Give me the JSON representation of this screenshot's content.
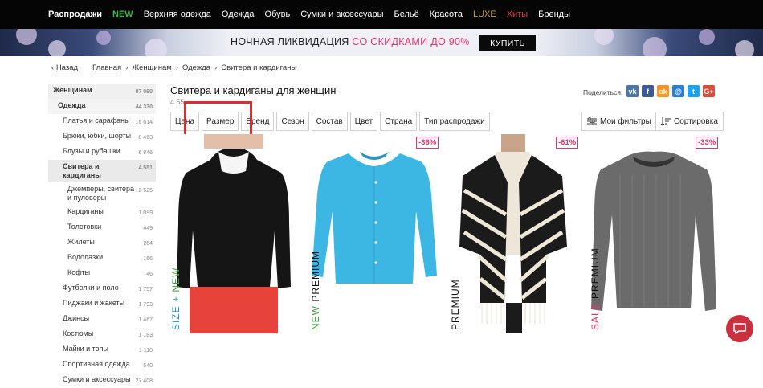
{
  "nav": {
    "items": [
      {
        "label": "Распродажи",
        "style": "bold"
      },
      {
        "label": "NEW",
        "style": "new"
      },
      {
        "label": "Верхняя одежда",
        "style": ""
      },
      {
        "label": "Одежда",
        "style": "under"
      },
      {
        "label": "Обувь",
        "style": ""
      },
      {
        "label": "Сумки и аксессуары",
        "style": ""
      },
      {
        "label": "Бельё",
        "style": ""
      },
      {
        "label": "Красота",
        "style": ""
      },
      {
        "label": "LUXE",
        "style": "luxe"
      },
      {
        "label": "Хиты",
        "style": "hits"
      },
      {
        "label": "Бренды",
        "style": ""
      }
    ]
  },
  "banner": {
    "text_main": "НОЧНАЯ ЛИКВИДАЦИЯ ",
    "text_accent": "СО СКИДКАМИ ДО 90%",
    "button": "КУПИТЬ"
  },
  "breadcrumb": {
    "back": "Назад",
    "items": [
      "Главная",
      "Женщинам",
      "Одежда"
    ],
    "current": "Свитера и кардиганы"
  },
  "sidebar": [
    {
      "label": "Женщинам",
      "count": "97 090",
      "level": "lvl0"
    },
    {
      "label": "Одежда",
      "count": "44 330",
      "level": "lvl1"
    },
    {
      "label": "Платья и сарафаны",
      "count": "16 614",
      "level": "lvl2"
    },
    {
      "label": "Брюки, юбки, шорты",
      "count": "8 463",
      "level": "lvl2"
    },
    {
      "label": "Блузы и рубашки",
      "count": "6 846",
      "level": "lvl2"
    },
    {
      "label": "Свитера и кардиганы",
      "count": "4 551",
      "level": "lvl2 active"
    },
    {
      "label": "Джемперы, свитера и пуловеры",
      "count": "2 525",
      "level": "lvl3"
    },
    {
      "label": "Кардиганы",
      "count": "1 099",
      "level": "lvl3"
    },
    {
      "label": "Толстовки",
      "count": "449",
      "level": "lvl3"
    },
    {
      "label": "Жилеты",
      "count": "264",
      "level": "lvl3"
    },
    {
      "label": "Водолазки",
      "count": "166",
      "level": "lvl3"
    },
    {
      "label": "Кофты",
      "count": "46",
      "level": "lvl3"
    },
    {
      "label": "Футболки и поло",
      "count": "1 757",
      "level": "lvl2"
    },
    {
      "label": "Пиджаки и жакеты",
      "count": "1 793",
      "level": "lvl2"
    },
    {
      "label": "Джинсы",
      "count": "1 467",
      "level": "lvl2"
    },
    {
      "label": "Костюмы",
      "count": "1 183",
      "level": "lvl2"
    },
    {
      "label": "Майки и топы",
      "count": "1 110",
      "level": "lvl2"
    },
    {
      "label": "Спортивная одежда",
      "count": "540",
      "level": "lvl2"
    },
    {
      "label": "Сумки и аксессуары",
      "count": "27 408",
      "level": "lvl1b"
    }
  ],
  "page": {
    "title": "Свитера и кардиганы для женщин",
    "count": "4 55"
  },
  "share": {
    "label": "Поделиться:",
    "networks": [
      {
        "name": "vk-icon",
        "glyph": "vk",
        "color": "#4a76a8"
      },
      {
        "name": "facebook-icon",
        "glyph": "f",
        "color": "#3b5998"
      },
      {
        "name": "odnoklassniki-icon",
        "glyph": "ok",
        "color": "#f7931e"
      },
      {
        "name": "moimir-icon",
        "glyph": "@",
        "color": "#2a7fd4"
      },
      {
        "name": "twitter-icon",
        "glyph": "t",
        "color": "#1da1f2"
      },
      {
        "name": "googleplus-icon",
        "glyph": "G+",
        "color": "#dd4b39"
      }
    ]
  },
  "filters": [
    "Цена",
    "Размер",
    "Бренд",
    "Сезон",
    "Состав",
    "Цвет",
    "Страна",
    "Тип распродажи"
  ],
  "right_buttons": {
    "my_filters": "Мои фильтры",
    "sort": "Сортировка"
  },
  "products": [
    {
      "badge": "",
      "tags": [
        {
          "text": "SIZE + ",
          "color": "#2a8fbf"
        },
        {
          "text": "NEW",
          "color": "#3a9e3a"
        }
      ],
      "garment": "black-sweater"
    },
    {
      "badge": "-36%",
      "tags": [
        {
          "text": "NEW ",
          "color": "#3a9e3a"
        },
        {
          "text": "PREMIUM",
          "color": "#111"
        }
      ],
      "garment": "blue-cardigan"
    },
    {
      "badge": "-61%",
      "tags": [
        {
          "text": "PREMIUM",
          "color": "#111"
        }
      ],
      "garment": "striped-poncho"
    },
    {
      "badge": "-33%",
      "tags": [
        {
          "text": "SALE ",
          "color": "#e2336b"
        },
        {
          "text": "PREMIUM",
          "color": "#111"
        }
      ],
      "garment": "grey-sweater"
    }
  ]
}
